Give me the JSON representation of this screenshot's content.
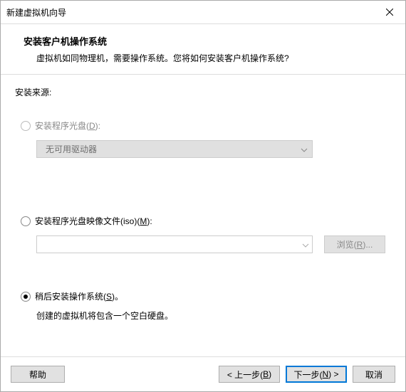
{
  "title": "新建虚拟机向导",
  "header": {
    "title": "安装客户机操作系统",
    "desc": "虚拟机如同物理机，需要操作系统。您将如何安装客户机操作系统?"
  },
  "source_label": "安装来源:",
  "options": {
    "disc": {
      "label_pre": "安装程序光盘(",
      "accel": "D",
      "label_post": "):",
      "dropdown_value": "无可用驱动器"
    },
    "iso": {
      "label_pre": "安装程序光盘映像文件(iso)(",
      "accel": "M",
      "label_post": "):",
      "browse_pre": "浏览(",
      "browse_accel": "R",
      "browse_post": ")...",
      "path": ""
    },
    "later": {
      "label_pre": "稍后安装操作系统(",
      "accel": "S",
      "label_post": ")。",
      "desc": "创建的虚拟机将包含一个空白硬盘。"
    }
  },
  "footer": {
    "help": "帮助",
    "back_pre": "< 上一步(",
    "back_accel": "B",
    "back_post": ")",
    "next_pre": "下一步(",
    "next_accel": "N",
    "next_post": ") >",
    "cancel": "取消"
  }
}
